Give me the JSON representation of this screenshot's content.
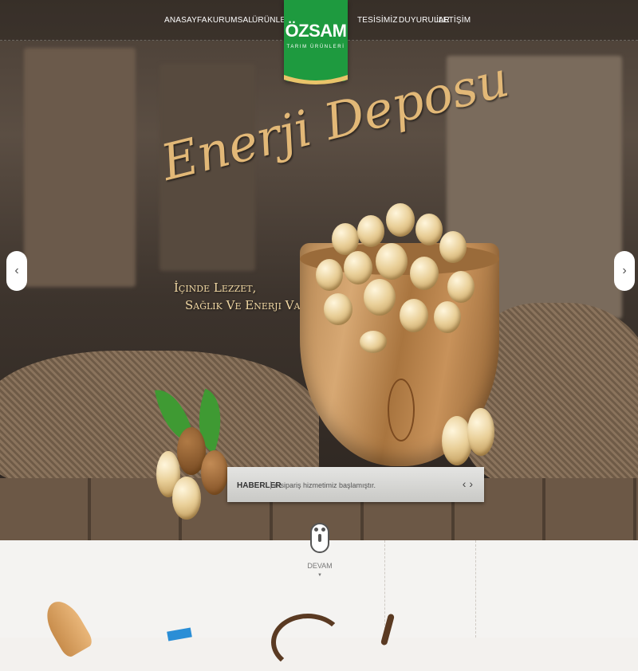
{
  "nav": {
    "items": [
      "ANASAYFA",
      "KURUMSAL",
      "ÜRÜNLER",
      "TESİSİMİZ",
      "DUYURULAR",
      "İLETİŞİM"
    ]
  },
  "logo": {
    "name": "ÖZSAM",
    "subtitle": "TARIM ÜRÜNLERİ"
  },
  "slider": {
    "headline": "Enerji Deposu",
    "sub_line1": "İçinde Lezzet,",
    "sub_line2": "Sağlık Ve Enerji Var !",
    "prev_arrow": "‹",
    "next_arrow": "›"
  },
  "news": {
    "label": "HABERLER",
    "text": "e sipariş hizmetimiz başlamıştır.",
    "nav": "‹ ›"
  },
  "scroll": {
    "label": "DEVAM"
  },
  "colors": {
    "brand_green": "#1e9a3f",
    "headline_gold": "#e2b877"
  }
}
